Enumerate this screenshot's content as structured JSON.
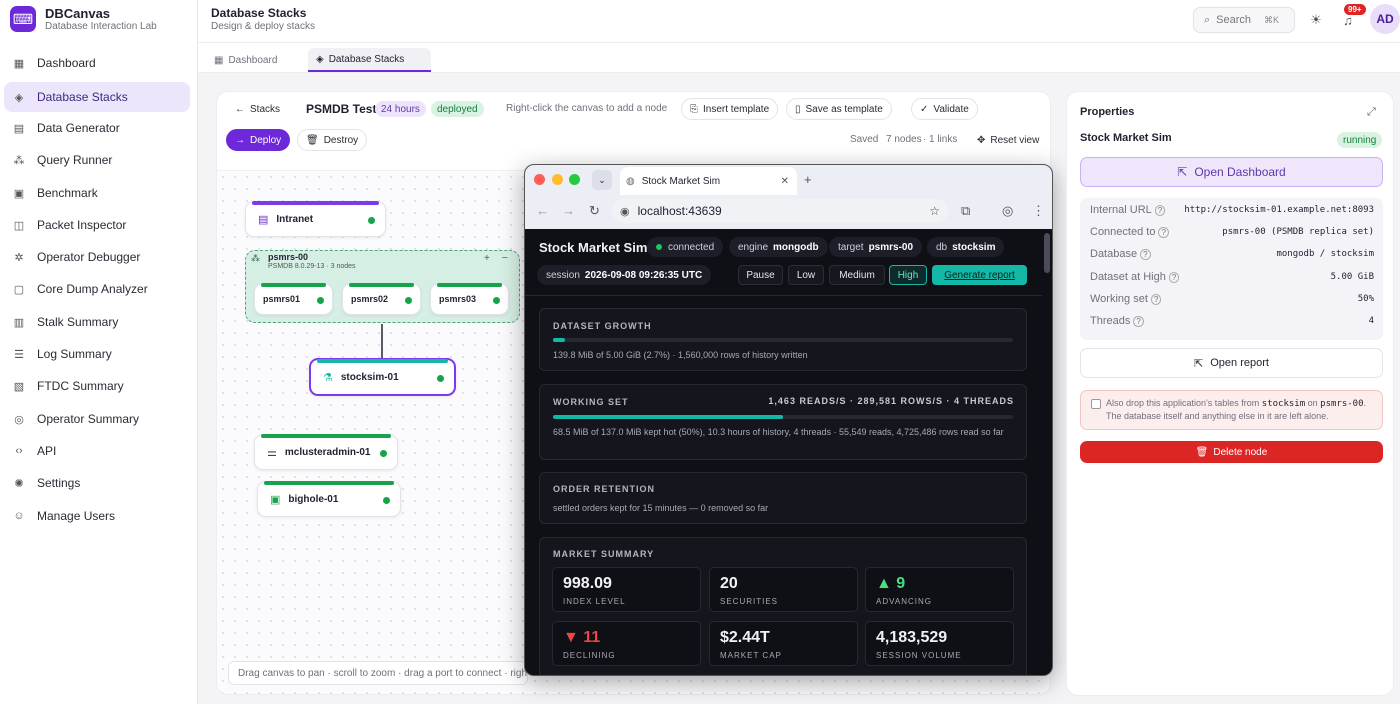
{
  "app": {
    "name": "DBCanvas",
    "subtitle": "Database Interaction Lab",
    "logo": "terminal-icon"
  },
  "sidebar": {
    "items": [
      {
        "label": "Dashboard",
        "icon": "grid-icon",
        "active": false
      },
      {
        "label": "Database Stacks",
        "icon": "layers-icon",
        "active": true
      },
      {
        "label": "Data Generator",
        "icon": "table-icon",
        "active": false
      },
      {
        "label": "Query Runner",
        "icon": "nodes-icon",
        "active": false
      },
      {
        "label": "Benchmark",
        "icon": "chart-icon",
        "active": false
      },
      {
        "label": "Packet Inspector",
        "icon": "puzzle-icon",
        "active": false
      },
      {
        "label": "Operator Debugger",
        "icon": "bug-icon",
        "active": false
      },
      {
        "label": "Core Dump Analyzer",
        "icon": "cpu-icon",
        "active": false
      },
      {
        "label": "Stalk Summary",
        "icon": "summary-icon",
        "active": false
      },
      {
        "label": "Log Summary",
        "icon": "log-icon",
        "active": false
      },
      {
        "label": "FTDC Summary",
        "icon": "doc-icon",
        "active": false
      },
      {
        "label": "Operator Summary",
        "icon": "globe-icon",
        "active": false
      },
      {
        "label": "API",
        "icon": "code-icon",
        "active": false
      },
      {
        "label": "Settings",
        "icon": "gear-icon",
        "active": false
      },
      {
        "label": "Manage Users",
        "icon": "users-icon",
        "active": false
      }
    ]
  },
  "header": {
    "title": "Database Stacks",
    "subtitle": "Design & deploy stacks",
    "search_label": "Search",
    "search_shortcut": "⌘K",
    "notifications": "99+",
    "avatar": "AD"
  },
  "tabs": [
    {
      "label": "Dashboard",
      "active": false
    },
    {
      "label": "Database Stacks",
      "active": true
    }
  ],
  "toolbar": {
    "back": "Stacks",
    "stack_name": "PSMDB Test",
    "ttl": "24 hours",
    "status": "deployed",
    "hint": "Right-click the canvas to add a node",
    "insert_template": "Insert template",
    "save_template": "Save as template",
    "validate": "Validate",
    "deploy": "Deploy",
    "destroy": "Destroy",
    "saved": "Saved",
    "nodes_count": "7 nodes",
    "links_count": "1 links",
    "reset_view": "Reset view"
  },
  "canvas": {
    "nodes": {
      "intranet": "Intranet",
      "stocksim": "stocksim-01",
      "mclusteradmin": "mclusteradmin-01",
      "bighole": "bighole-01"
    },
    "group": {
      "name": "psmrs-00",
      "meta": "PSMDB 8.0.29-13 · 3 nodes",
      "members": [
        "psmrs01",
        "psmrs02",
        "psmrs03"
      ]
    },
    "footer_hint": "Drag canvas to pan · scroll to zoom · drag a port to connect · right-cli"
  },
  "browser": {
    "tab_title": "Stock Market Sim",
    "url": "localhost:43639"
  },
  "sim": {
    "title": "Stock Market Sim",
    "connected": "connected",
    "engine_label": "engine",
    "engine": "mongodb",
    "target_label": "target",
    "target": "psmrs-00",
    "db_label": "db",
    "db": "stocksim",
    "session_label": "session",
    "session": "2026-09-08 09:26:35 UTC",
    "buttons": {
      "pause": "Pause",
      "low": "Low",
      "medium": "Medium",
      "high": "High",
      "report": "Generate report"
    },
    "growth": {
      "title": "DATASET GROWTH",
      "text": "139.8 MiB of 5.00 GiB (2.7%) · 1,560,000 rows of history written",
      "progress": 0.027
    },
    "working": {
      "title": "WORKING SET",
      "stats": "1,463 READS/S · 289,581 ROWS/S · 4 THREADS",
      "text": "68.5 MiB of 137.0 MiB kept hot (50%), 10.3 hours of history, 4 threads · 55,549 reads, 4,725,486 rows read so far",
      "progress": 0.5
    },
    "retention": {
      "title": "ORDER RETENTION",
      "text": "settled orders kept for 15 minutes — 0 removed so far"
    },
    "market": {
      "title": "MARKET SUMMARY",
      "stats": [
        {
          "value": "998.09",
          "label": "INDEX LEVEL"
        },
        {
          "value": "20",
          "label": "SECURITIES"
        },
        {
          "value": "▲ 9",
          "label": "ADVANCING"
        },
        {
          "value": "▼ 11",
          "label": "DECLINING"
        },
        {
          "value": "$2.44T",
          "label": "MARKET CAP"
        },
        {
          "value": "4,183,529",
          "label": "SESSION VOLUME"
        }
      ]
    }
  },
  "properties": {
    "title": "Properties",
    "node_name": "Stock Market Sim",
    "status": "running",
    "open_dashboard": "Open Dashboard",
    "rows": [
      {
        "key": "Internal URL",
        "value": "http://stocksim-01.example.net:8093"
      },
      {
        "key": "Connected to",
        "value": "psmrs-00 (PSMDB replica set)"
      },
      {
        "key": "Database",
        "value": "mongodb / stocksim"
      },
      {
        "key": "Dataset at High",
        "value": "5.00 GiB"
      },
      {
        "key": "Working set",
        "value": "50%"
      },
      {
        "key": "Threads",
        "value": "4"
      }
    ],
    "open_report": "Open report",
    "drop_prefix": "Also drop this application's tables from ",
    "drop_db": "stocksim",
    "drop_on": " on ",
    "drop_target": "psmrs-00",
    "drop_suffix": ". The database itself and anything else in it are left alone.",
    "delete": "Delete node"
  },
  "colors": {
    "accent": "#6d28d9",
    "success": "#16a34a",
    "danger": "#dc2626",
    "teal": "#14b8a6"
  }
}
